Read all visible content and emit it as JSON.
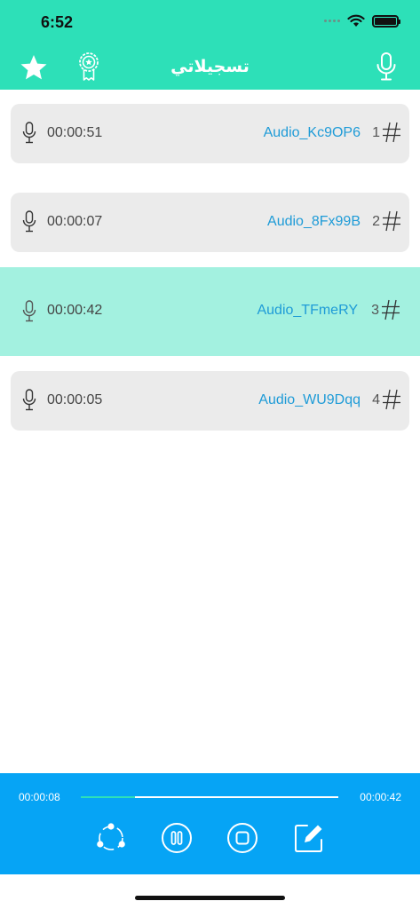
{
  "status_bar": {
    "time": "6:52"
  },
  "nav": {
    "title": "تسجيلاتي",
    "icons": [
      "star-icon",
      "award-badge-icon",
      "microphone-icon"
    ]
  },
  "recordings": [
    {
      "duration": "00:00:51",
      "name": "Audio_Kc9OP6",
      "number": "1",
      "active": false
    },
    {
      "duration": "00:00:07",
      "name": "Audio_8Fx99B",
      "number": "2",
      "active": false
    },
    {
      "duration": "00:00:42",
      "name": "Audio_TFmeRY",
      "number": "3",
      "active": true
    },
    {
      "duration": "00:00:05",
      "name": "Audio_WU9Dqq",
      "number": "4",
      "active": false
    }
  ],
  "player": {
    "elapsed": "00:00:08",
    "total": "00:00:42",
    "progress_percent": 21,
    "buttons": [
      "share-icon",
      "pause-icon",
      "stop-icon",
      "edit-icon"
    ]
  },
  "colors": {
    "header": "#2de0b8",
    "active_row": "#a3f1e0",
    "row": "#ebebeb",
    "link": "#1e9bd7",
    "player": "#06a4f5"
  }
}
